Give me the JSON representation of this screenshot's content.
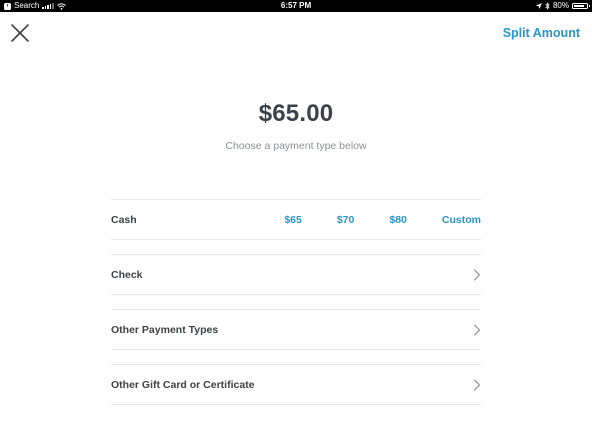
{
  "status_bar": {
    "back_label": "Search",
    "time": "6:57 PM",
    "battery": "80%"
  },
  "header": {
    "split_label": "Split Amount"
  },
  "payment": {
    "amount": "$65.00",
    "subtitle": "Choose a payment type below"
  },
  "rows": {
    "cash": {
      "label": "Cash",
      "options": [
        "$65",
        "$70",
        "$80",
        "Custom"
      ]
    },
    "check": {
      "label": "Check"
    },
    "other_types": {
      "label": "Other Payment Types"
    },
    "gift_card": {
      "label": "Other Gift Card or Certificate"
    }
  },
  "colors": {
    "accent": "#2b95c8",
    "text": "#3d4248",
    "muted": "#8b9095",
    "divider": "#e4e6e8"
  }
}
